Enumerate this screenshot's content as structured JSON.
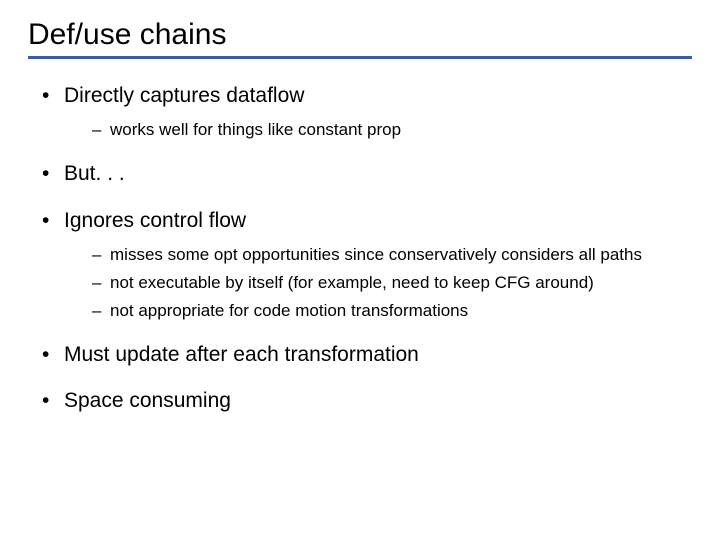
{
  "title": "Def/use chains",
  "bullets": [
    {
      "text": "Directly captures dataflow",
      "sub": [
        "works well for things like constant prop"
      ]
    },
    {
      "text": "But. . .",
      "sub": []
    },
    {
      "text": "Ignores control flow",
      "sub": [
        "misses some opt opportunities since conservatively considers all paths",
        "not executable by itself (for example, need to keep CFG around)",
        "not appropriate for code motion transformations"
      ]
    },
    {
      "text": "Must update after each transformation",
      "sub": []
    },
    {
      "text": "Space consuming",
      "sub": []
    }
  ]
}
